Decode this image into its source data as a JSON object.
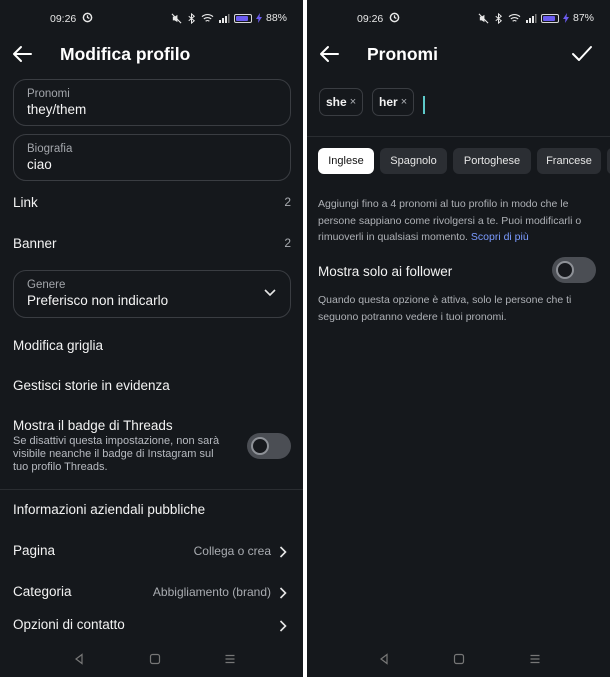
{
  "left": {
    "status": {
      "time": "09:26",
      "battery": "88%",
      "battery_level": 0.88
    },
    "header": {
      "title": "Modifica profilo"
    },
    "pronouns": {
      "label": "Pronomi",
      "value": "they/them"
    },
    "bio": {
      "label": "Biografia",
      "value": "ciao"
    },
    "link": {
      "label": "Link",
      "count": "2"
    },
    "banner": {
      "label": "Banner",
      "count": "2"
    },
    "gender": {
      "label": "Genere",
      "value": "Preferisco non indicarlo"
    },
    "grid": {
      "label": "Modifica griglia"
    },
    "stories": {
      "label": "Gestisci storie in evidenza"
    },
    "threads": {
      "label": "Mostra il badge di Threads",
      "desc": "Se disattivi questa impostazione, non sarà visibile neanche il badge di Instagram sul tuo profilo Threads.",
      "toggle_on": false
    },
    "business": {
      "label": "Informazioni aziendali pubbliche"
    },
    "page": {
      "label": "Pagina",
      "value": "Collega o crea"
    },
    "category": {
      "label": "Categoria",
      "value": "Abbigliamento (brand)"
    },
    "contact": {
      "label": "Opzioni di contatto"
    }
  },
  "right": {
    "status": {
      "time": "09:26",
      "battery": "87%",
      "battery_level": 0.87
    },
    "header": {
      "title": "Pronomi"
    },
    "chips": [
      {
        "label": "she",
        "remove": "×"
      },
      {
        "label": "her",
        "remove": "×"
      }
    ],
    "tabs": [
      "Inglese",
      "Spagnolo",
      "Portoghese",
      "Francese"
    ],
    "active_tab": "Inglese",
    "info": {
      "text": "Aggiungi fino a 4 pronomi al tuo profilo in modo che le persone sappiano come rivolgersi a te. Puoi modificarli o rimuoverli in qualsiasi momento. ",
      "link": "Scopri di più"
    },
    "followers": {
      "label": "Mostra solo ai follower",
      "desc": "Quando questa opzione è attiva, solo le persone che ti seguono potranno vedere i tuoi pronomi.",
      "toggle_on": false
    }
  },
  "colors": {
    "background": "#15181c",
    "accent": "#7b9bff",
    "cursor": "#5dc9c9",
    "battery": "#6b5cf0"
  }
}
